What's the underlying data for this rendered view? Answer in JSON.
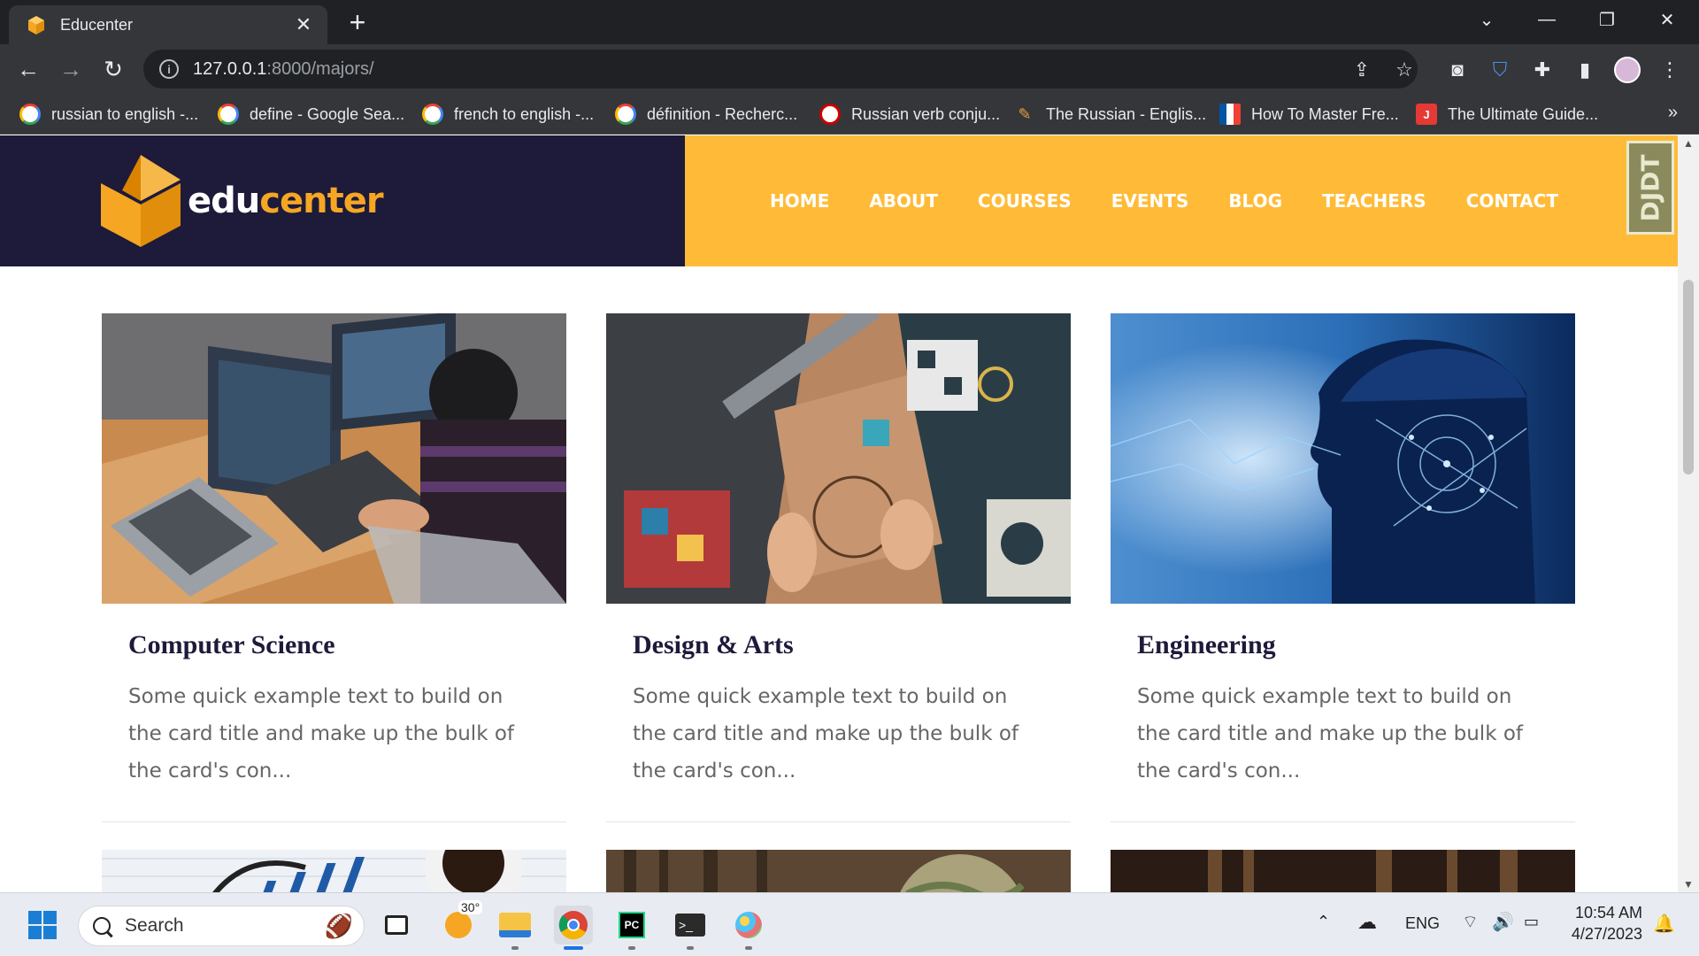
{
  "browser": {
    "tab_title": "Educenter",
    "tab_close": "✕",
    "new_tab": "+",
    "url_host": "127.0.0.1",
    "url_path": ":8000/majors/",
    "bookmarks": [
      {
        "label": "russian to english -...",
        "icon": "google-icon"
      },
      {
        "label": "define - Google Sea...",
        "icon": "google-icon"
      },
      {
        "label": "french to english -...",
        "icon": "google-icon"
      },
      {
        "label": "définition - Recherc...",
        "icon": "google-icon"
      },
      {
        "label": "Russian verb conju...",
        "icon": "reverso-icon"
      },
      {
        "label": "The Russian - Englis...",
        "icon": "quill-icon"
      },
      {
        "label": "How To Master Fre...",
        "icon": "french-flag-icon"
      },
      {
        "label": "The Ultimate Guide...",
        "icon": "j-icon"
      }
    ],
    "bookmarks_more": "»"
  },
  "site": {
    "logo_part1": "edu",
    "logo_part2": "center",
    "nav": [
      "HOME",
      "ABOUT",
      "COURSES",
      "EVENTS",
      "BLOG",
      "TEACHERS",
      "CONTACT"
    ],
    "debug_toolbar": "DJDT",
    "colors": {
      "header_dark": "#1d1a3a",
      "header_accent": "#ffbb38",
      "logo_orange": "#f5a623"
    }
  },
  "majors": [
    {
      "title": "Computer Science",
      "text": "Some quick example text to build on the card title and make up the bulk of the card's con..."
    },
    {
      "title": "Design & Arts",
      "text": "Some quick example text to build on the card title and make up the bulk of the card's con..."
    },
    {
      "title": "Engineering",
      "text": "Some quick example text to build on the card title and make up the bulk of the card's con..."
    }
  ],
  "taskbar": {
    "search_label": "Search",
    "weather_temp": "30°",
    "language": "ENG",
    "time": "10:54 AM",
    "date": "4/27/2023"
  }
}
